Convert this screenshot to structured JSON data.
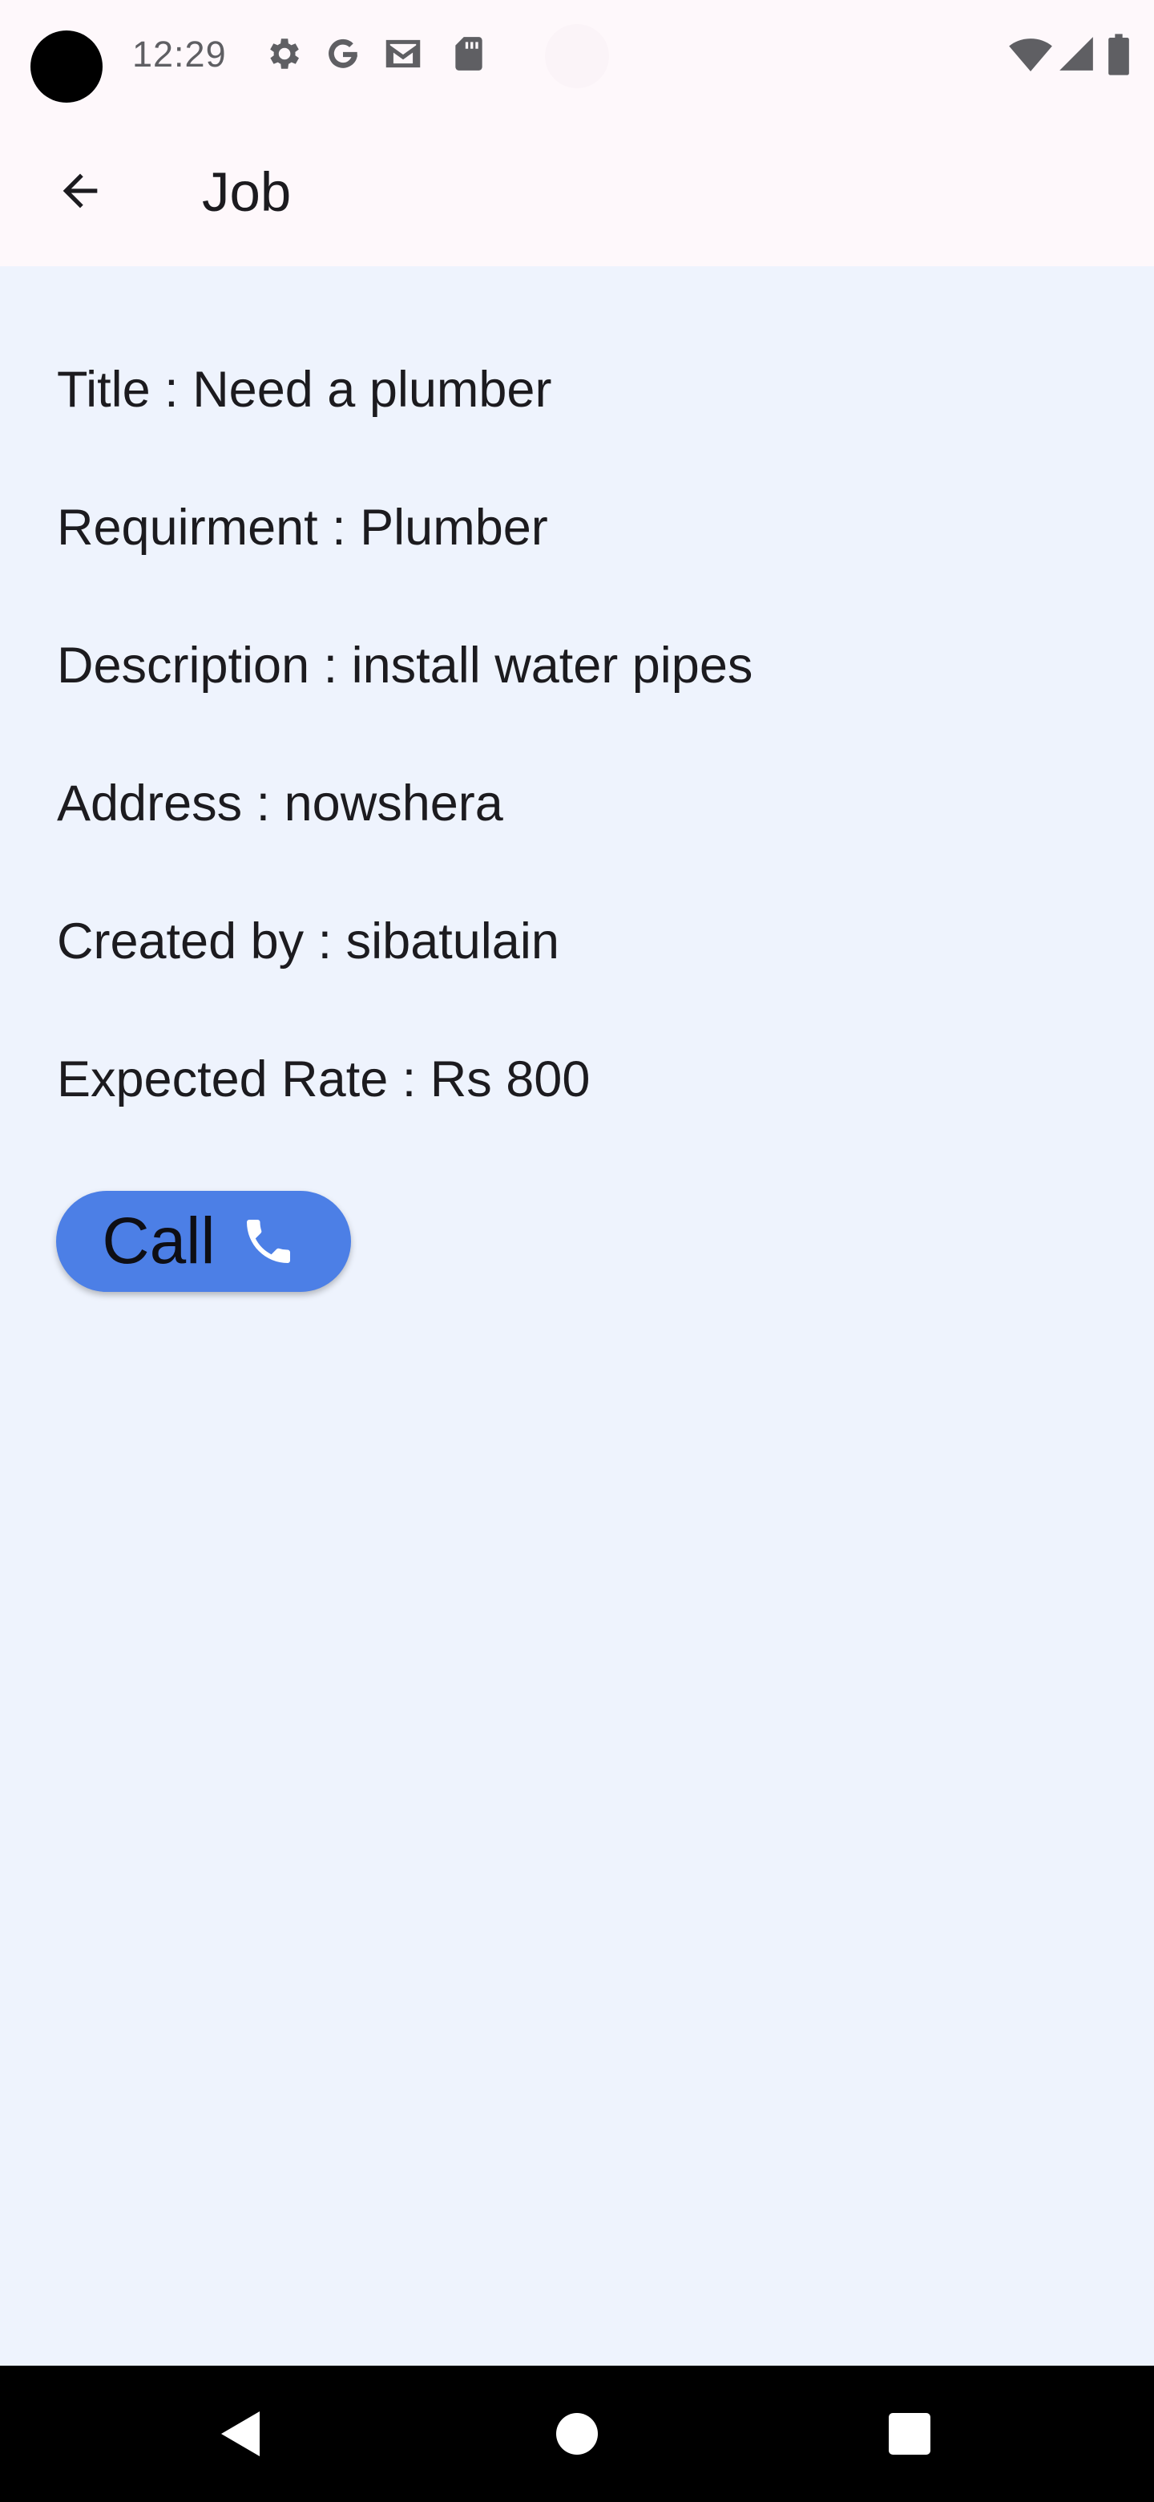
{
  "status_bar": {
    "time": "12:29",
    "left_icons": [
      "settings-icon",
      "google-icon",
      "gmail-icon",
      "sd-card-icon"
    ],
    "right_icons": [
      "wifi-icon",
      "cell-signal-icon",
      "battery-icon"
    ]
  },
  "app_bar": {
    "title": "Job",
    "back_icon": "arrow-back-icon"
  },
  "job": {
    "title_line": "Title : Need a plumber",
    "requirement_line": "Requirment : Plumber",
    "description_line": "Description : install water pipes",
    "address_line": "Address : nowshera",
    "created_by_line": "Created by : sibatulain",
    "rate_line": "Expected Rate : Rs 800"
  },
  "call_button": {
    "label": "Call",
    "icon": "phone-icon",
    "color": "#4C7FE6"
  },
  "nav_bar": {
    "buttons": [
      "back-triangle-icon",
      "home-circle-icon",
      "recents-square-icon"
    ]
  },
  "colors": {
    "background": "#EEF3FD",
    "app_bar": "#FEF8FB",
    "text": "#1C1B1F"
  }
}
